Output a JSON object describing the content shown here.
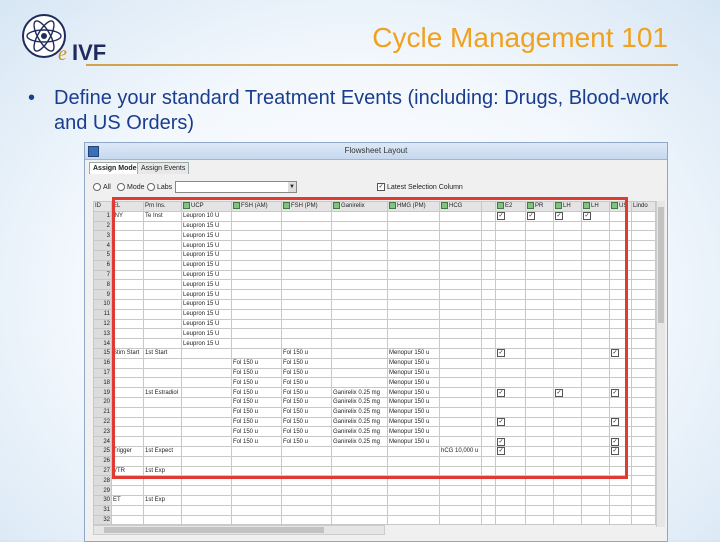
{
  "slide": {
    "title": "Cycle Management 101",
    "bullet": "Define your standard Treatment Events (including: Drugs, Blood-work and US Orders)",
    "logo_text": "eIVF",
    "colors": {
      "title": "#f0a11e",
      "bullet": "#1a3d8f",
      "highlight": "#e03a32"
    }
  },
  "window": {
    "title": "Flowsheet Layout",
    "tabs": [
      "Assign Mode",
      "Assign Events"
    ],
    "filters": {
      "all": "All",
      "mode": "Mode",
      "labs": "Labs",
      "labs_value": "",
      "checkbox_label": "Latest Selection Column"
    },
    "columns": [
      "ID",
      "EL",
      "Prn Ins.",
      "UCP",
      "FSH (AM)",
      "FSH (PM)",
      "Ganirelix",
      "HMG (PM)",
      "HCG",
      "",
      "E2",
      "PR",
      "LH",
      "LH",
      "US",
      "Lindo"
    ],
    "rows": [
      {
        "id": "1",
        "el": "INY",
        "prn": "Te Inst",
        "ucp": "Leupron 10 U",
        "e2": "✓",
        "pr": "✓",
        "lh1": "✓",
        "lh2": "✓"
      },
      {
        "id": "2",
        "ucp": "Leupron 15 U"
      },
      {
        "id": "3",
        "ucp": "Leupron 15 U"
      },
      {
        "id": "4",
        "ucp": "Leupron 15 U"
      },
      {
        "id": "5",
        "ucp": "Leupron 15 U"
      },
      {
        "id": "6",
        "ucp": "Leupron 15 U"
      },
      {
        "id": "7",
        "ucp": "Leupron 15 U"
      },
      {
        "id": "8",
        "ucp": "Leupron 15 U"
      },
      {
        "id": "9",
        "ucp": "Leupron 15 U"
      },
      {
        "id": "10",
        "ucp": "Leupron 15 U"
      },
      {
        "id": "11",
        "ucp": "Leupron 15 U"
      },
      {
        "id": "12",
        "ucp": "Leupron 15 U"
      },
      {
        "id": "13",
        "ucp": "Leupron 15 U"
      },
      {
        "id": "14",
        "ucp": "Leupron 15 U"
      },
      {
        "id": "15",
        "el": "Stim Start",
        "prn": "1st Start",
        "fsham": "",
        "fshpm": "Fol 150 u",
        "hmg": "Menopur 150 u",
        "e2": "✓",
        "us": "✓"
      },
      {
        "id": "16",
        "fsham": "Fol 150 u",
        "fshpm": "Fol 150 u",
        "hmg": "Menopur 150 u"
      },
      {
        "id": "17",
        "fsham": "Fol 150 u",
        "fshpm": "Fol 150 u",
        "hmg": "Menopur 150 u"
      },
      {
        "id": "18",
        "fsham": "Fol 150 u",
        "fshpm": "Fol 150 u",
        "hmg": "Menopur 150 u"
      },
      {
        "id": "19",
        "prn": "1st Estradiol",
        "fsham": "Fol 150 u",
        "fshpm": "Fol 150 u",
        "gan": "Ganirelix 0.25 mg",
        "hmg": "Menopur 150 u",
        "e2": "✓",
        "lh1": "✓",
        "us": "✓"
      },
      {
        "id": "20",
        "fsham": "Fol 150 u",
        "fshpm": "Fol 150 u",
        "gan": "Ganirelix 0.25 mg",
        "hmg": "Menopur 150 u"
      },
      {
        "id": "21",
        "fsham": "Fol 150 u",
        "fshpm": "Fol 150 u",
        "gan": "Ganirelix 0.25 mg",
        "hmg": "Menopur 150 u"
      },
      {
        "id": "22",
        "fsham": "Fol 150 u",
        "fshpm": "Fol 150 u",
        "gan": "Ganirelix 0.25 mg",
        "hmg": "Menopur 150 u",
        "e2": "✓",
        "us": "✓"
      },
      {
        "id": "23",
        "fsham": "Fol 150 u",
        "fshpm": "Fol 150 u",
        "gan": "Ganirelix 0.25 mg",
        "hmg": "Menopur 150 u"
      },
      {
        "id": "24",
        "fsham": "Fol 150 u",
        "fshpm": "Fol 150 u",
        "gan": "Ganirelix 0.25 mg",
        "hmg": "Menopur 150 u",
        "e2": "✓",
        "us": "✓"
      },
      {
        "id": "25",
        "el": "Trigger",
        "prn": "1st Expect",
        "hcg": "hCG 10,000 u",
        "e2": "✓",
        "us": "✓"
      },
      {
        "id": "26"
      },
      {
        "id": "27",
        "el": "VTR",
        "prn": "1st Exp"
      },
      {
        "id": "28"
      },
      {
        "id": "29"
      },
      {
        "id": "30",
        "el": "ET",
        "prn": "1st Exp"
      },
      {
        "id": "31"
      },
      {
        "id": "32"
      }
    ]
  }
}
